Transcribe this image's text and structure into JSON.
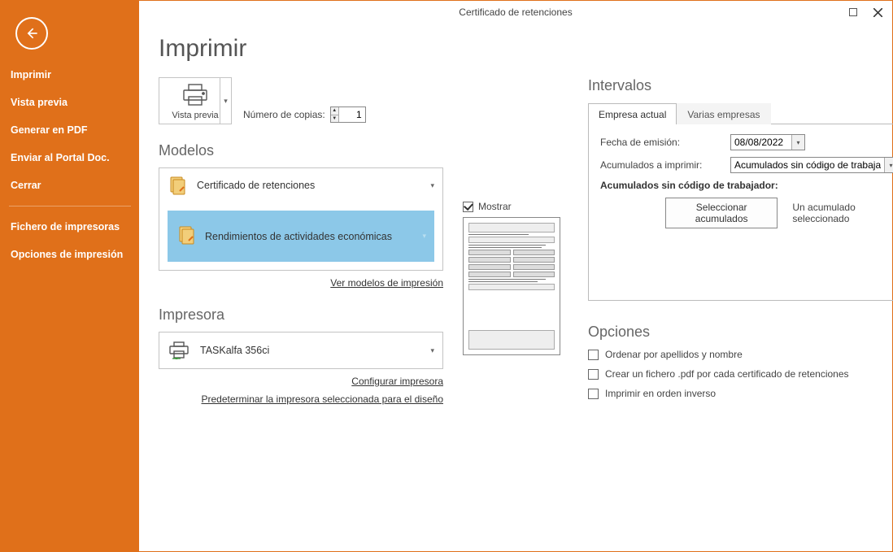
{
  "window": {
    "title": "Certificado de retenciones"
  },
  "sidebar": {
    "items": [
      "Imprimir",
      "Vista previa",
      "Generar en PDF",
      "Enviar al Portal Doc.",
      "Cerrar"
    ],
    "items2": [
      "Fichero de impresoras",
      "Opciones de impresión"
    ]
  },
  "page": {
    "title": "Imprimir",
    "vista_previa_label": "Vista previa",
    "copies_label": "Número de copias:",
    "copies_value": "1"
  },
  "models": {
    "heading": "Modelos",
    "item_main": "Certificado de retenciones",
    "item_sub": "Rendimientos de actividades económicas",
    "link": "Ver modelos de impresión"
  },
  "printer": {
    "heading": "Impresora",
    "name": "TASKalfa 356ci",
    "link_config": "Configurar impresora",
    "link_default": "Predeterminar la impresora seleccionada para el diseño"
  },
  "preview": {
    "show_label": "Mostrar"
  },
  "intervals": {
    "heading": "Intervalos",
    "tab_current": "Empresa actual",
    "tab_multi": "Varias empresas",
    "emission_label": "Fecha de emisión:",
    "emission_value": "08/08/2022",
    "acc_print_label": "Acumulados a imprimir:",
    "acc_print_value": "Acumulados sin código de trabajador",
    "bold_label": "Acumulados sin código de trabajador:",
    "select_btn": "Seleccionar acumulados",
    "status": "Un acumulado seleccionado"
  },
  "options": {
    "heading": "Opciones",
    "opt1": "Ordenar por apellidos y nombre",
    "opt2": "Crear un fichero .pdf por cada certificado de retenciones",
    "opt3": "Imprimir en orden inverso"
  }
}
